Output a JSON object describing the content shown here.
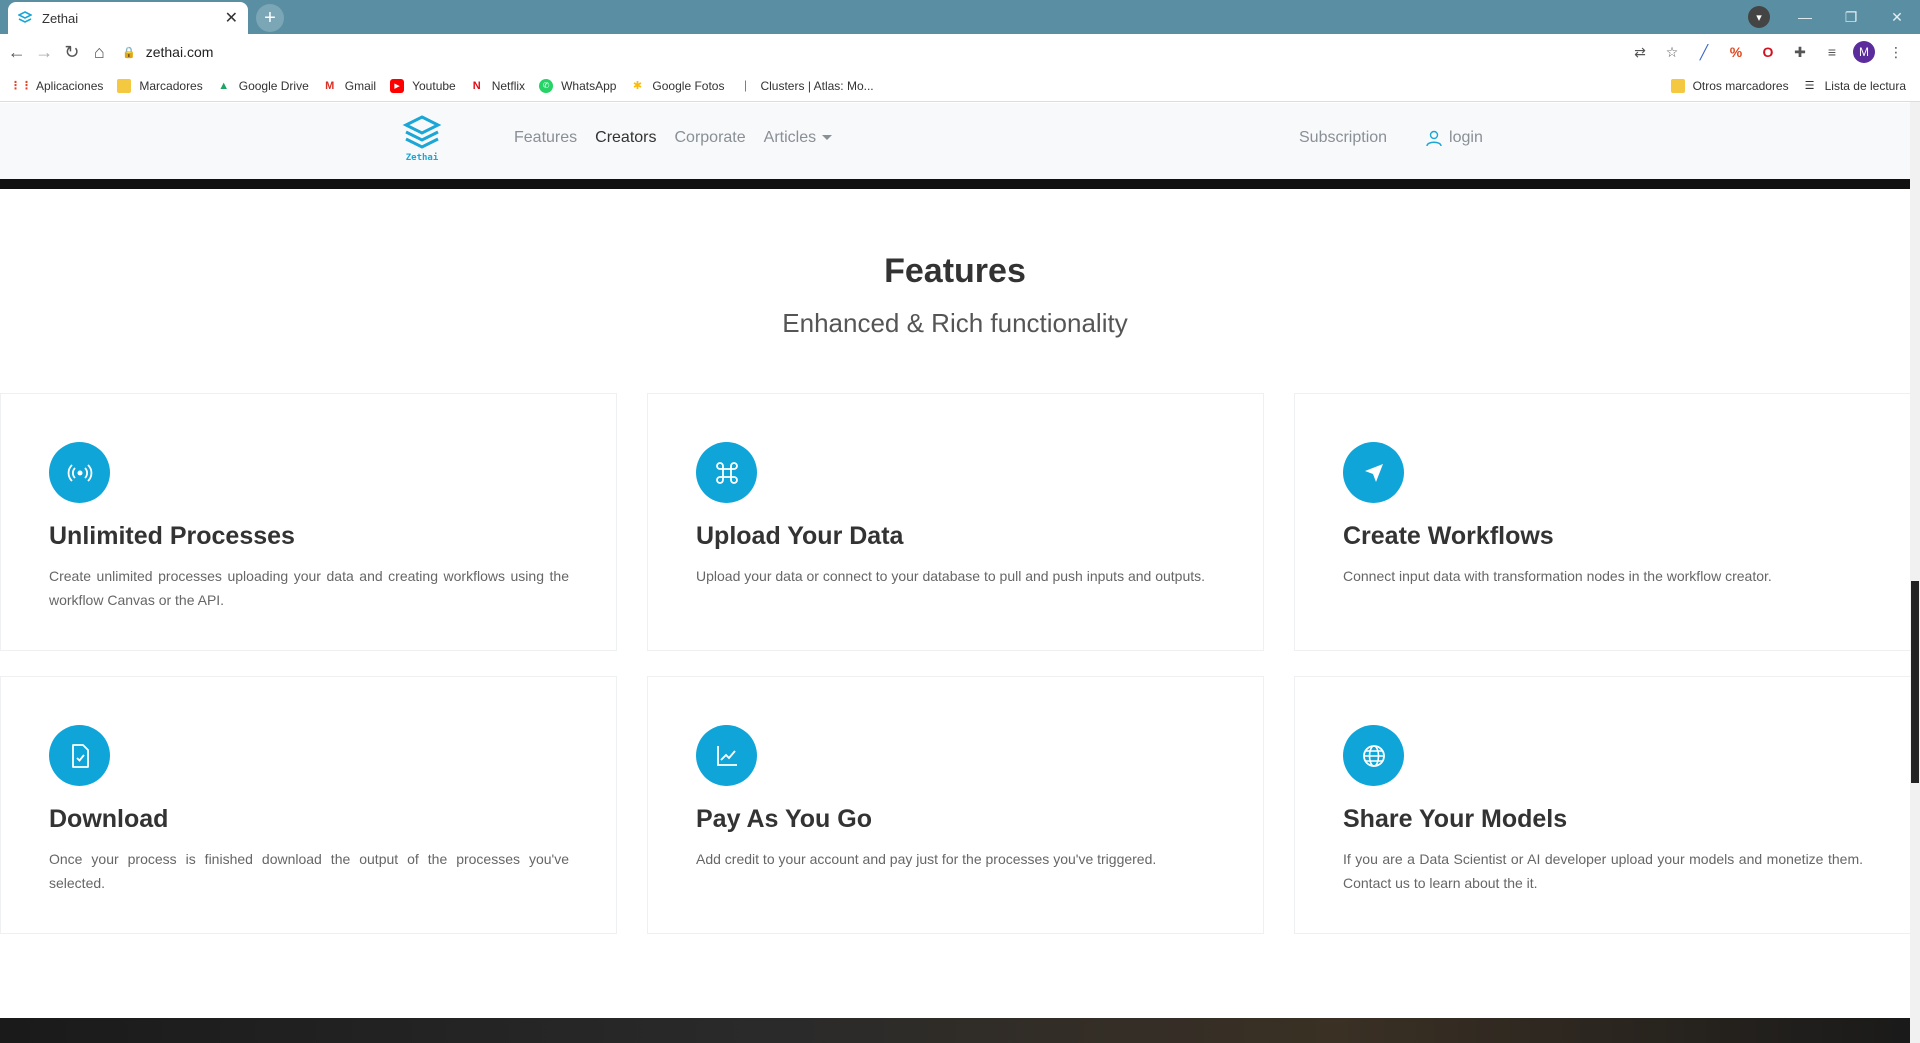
{
  "browser": {
    "tab_title": "Zethai",
    "url": "zethai.com",
    "profile_initial": "M",
    "bookmarks": [
      {
        "label": "Aplicaciones",
        "icon": "apps-grid-icon"
      },
      {
        "label": "Marcadores",
        "icon": "folder-icon"
      },
      {
        "label": "Google Drive",
        "icon": "google-drive-icon"
      },
      {
        "label": "Gmail",
        "icon": "gmail-icon"
      },
      {
        "label": "Youtube",
        "icon": "youtube-icon"
      },
      {
        "label": "Netflix",
        "icon": "netflix-icon"
      },
      {
        "label": "WhatsApp",
        "icon": "whatsapp-icon"
      },
      {
        "label": "Google Fotos",
        "icon": "google-photos-icon"
      },
      {
        "label": "Clusters | Atlas: Mo...",
        "icon": "mongodb-leaf-icon"
      }
    ],
    "bookmarks_right": [
      {
        "label": "Otros marcadores",
        "icon": "folder-icon"
      },
      {
        "label": "Lista de lectura",
        "icon": "reading-list-icon"
      }
    ]
  },
  "site": {
    "logo_text": "Zethai",
    "nav": [
      "Features",
      "Creators",
      "Corporate",
      "Articles"
    ],
    "subscription": "Subscription",
    "login": "login"
  },
  "features": {
    "title": "Features",
    "subtitle": "Enhanced & Rich functionality",
    "cards": [
      {
        "title": "Unlimited Processes",
        "desc": "Create unlimited processes uploading your data and creating workflows using the workflow Canvas or the API.",
        "icon": "broadcast-icon"
      },
      {
        "title": "Upload Your Data",
        "desc": "Upload your data or connect to your database to pull and push inputs and outputs.",
        "icon": "command-icon"
      },
      {
        "title": "Create Workflows",
        "desc": "Connect input data with transformation nodes in the workflow creator.",
        "icon": "navigation-arrow-icon"
      },
      {
        "title": "Download",
        "desc": "Once your process is finished download the output of the processes you've selected.",
        "icon": "file-check-icon"
      },
      {
        "title": "Pay As You Go",
        "desc": "Add credit to your account and pay just for the processes you've triggered.",
        "icon": "line-chart-icon"
      },
      {
        "title": "Share Your Models",
        "desc": "If you are a Data Scientist or AI developer upload your models and monetize them. Contact us to learn about the it.",
        "icon": "globe-icon"
      }
    ]
  },
  "colors": {
    "accent": "#0fa5d8",
    "tabbar": "#5a8fa3"
  }
}
